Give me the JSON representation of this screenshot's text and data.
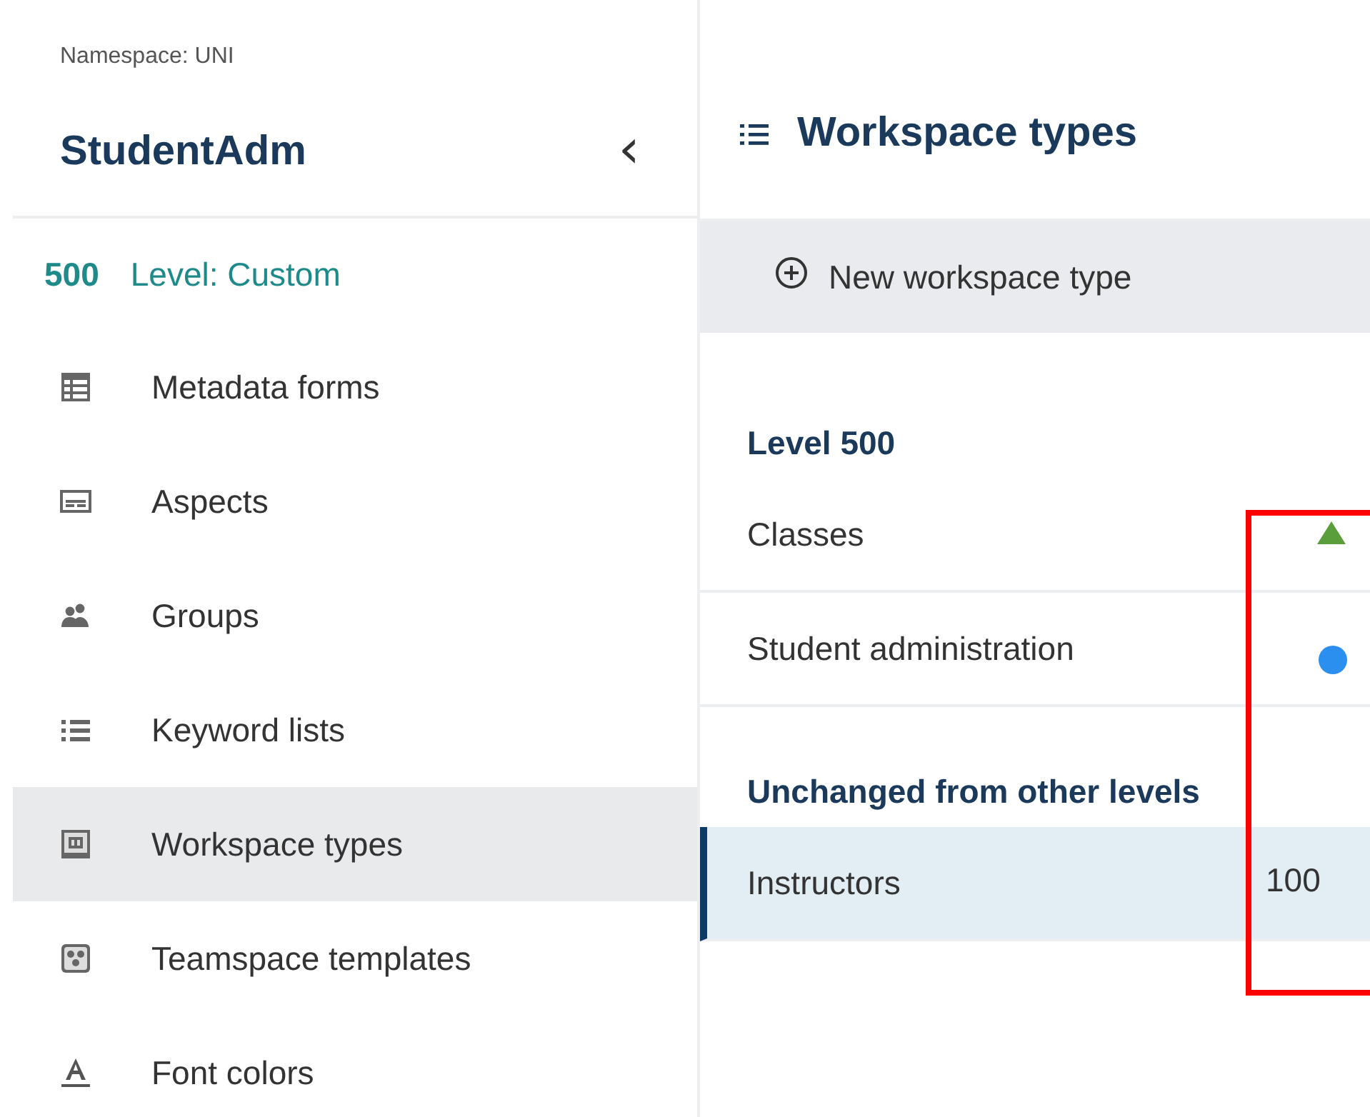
{
  "sidebar": {
    "namespace": "Namespace: UNI",
    "title": "StudentAdm",
    "collapse_icon": "‹",
    "level": {
      "number": "500",
      "label": "Level: Custom"
    },
    "items": [
      {
        "label": "Metadata forms",
        "kind": "table",
        "selected": false
      },
      {
        "label": "Aspects",
        "kind": "card",
        "selected": false
      },
      {
        "label": "Groups",
        "kind": "people",
        "selected": false
      },
      {
        "label": "Keyword lists",
        "kind": "list",
        "selected": false
      },
      {
        "label": "Workspace types",
        "kind": "workspace",
        "selected": true
      },
      {
        "label": "Teamspace templates",
        "kind": "teamspace",
        "selected": false
      },
      {
        "label": "Font colors",
        "kind": "font",
        "selected": false
      }
    ]
  },
  "main": {
    "title": "Workspace types",
    "toolbar": {
      "new_button": "New workspace type"
    },
    "sections": [
      {
        "heading": "Level 500",
        "rows": [
          {
            "name": "Classes",
            "selected": false,
            "marker": {
              "kind": "triangle",
              "color": "#5a9e3c"
            }
          },
          {
            "name": "Student administration",
            "selected": false,
            "marker": {
              "kind": "dot",
              "color": "#2b8ff0"
            }
          }
        ]
      },
      {
        "heading": "Unchanged from other levels",
        "rows": [
          {
            "name": "Instructors",
            "selected": true,
            "marker": {
              "kind": "level",
              "text": "100"
            }
          }
        ]
      }
    ]
  }
}
